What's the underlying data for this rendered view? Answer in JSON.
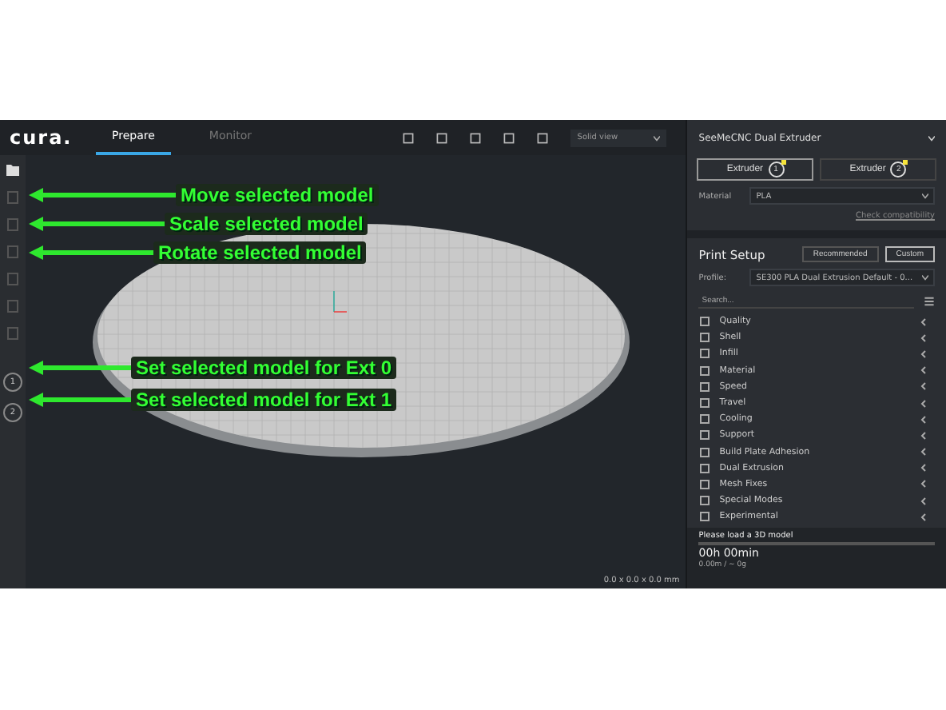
{
  "header": {
    "logo": "cura.",
    "tabs": [
      {
        "label": "Prepare",
        "selected": true
      },
      {
        "label": "Monitor",
        "selected": false
      }
    ],
    "view_mode": "Solid view"
  },
  "toolbar": {
    "ext_buttons": [
      "1",
      "2"
    ]
  },
  "annotations": [
    {
      "text": "Move selected model"
    },
    {
      "text": "Scale selected model"
    },
    {
      "text": "Rotate selected model"
    },
    {
      "text": "Set selected model for Ext 0"
    },
    {
      "text": "Set selected model for Ext 1"
    }
  ],
  "viewport": {
    "dimensions": "0.0 x 0.0 x 0.0 mm"
  },
  "machine": {
    "name": "SeeMeCNC Dual Extruder",
    "extruders": [
      {
        "label": "Extruder",
        "number": "1",
        "selected": true
      },
      {
        "label": "Extruder",
        "number": "2",
        "selected": false
      }
    ],
    "material_label": "Material",
    "material": "PLA",
    "check_link": "Check compatibility"
  },
  "print_setup": {
    "title": "Print Setup",
    "modes": [
      {
        "label": "Recommended",
        "selected": false
      },
      {
        "label": "Custom",
        "selected": true
      }
    ],
    "profile_label": "Profile:",
    "profile": "SE300 PLA Dual Extrusion Default - 0...",
    "search_placeholder": "Search...",
    "categories": [
      "Quality",
      "Shell",
      "Infill",
      "Material",
      "Speed",
      "Travel",
      "Cooling",
      "Support",
      "Build Plate Adhesion",
      "Dual Extrusion",
      "Mesh Fixes",
      "Special Modes",
      "Experimental"
    ]
  },
  "status": {
    "message": "Please load a 3D model",
    "level": 0,
    "time": "00h 00min",
    "usage": "0.00m / ~ 0g"
  }
}
